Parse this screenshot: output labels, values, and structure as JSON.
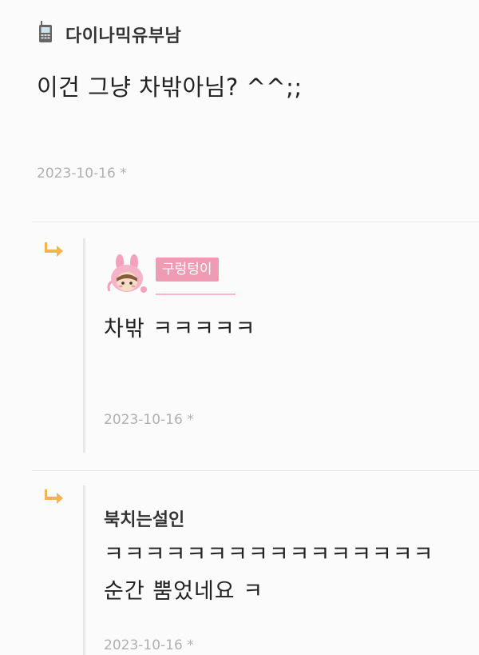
{
  "top_comment": {
    "icon": "mobile-phone-icon",
    "nickname": "다이나믹유부남",
    "text": "이건 그냥 차밖아님? ^^;;",
    "date": "2023-10-16 *"
  },
  "replies": [
    {
      "icon": "reply-arrow-icon",
      "avatar": "pink-bunny-avatar",
      "nickname_badge": "구렁텅이",
      "badge_color": "#f09bb4",
      "text": "차밖 ㅋㅋㅋㅋㅋ",
      "date": "2023-10-16 *"
    },
    {
      "icon": "reply-arrow-icon",
      "nickname": "북치는설인",
      "text_line1": "ㅋㅋㅋㅋㅋㅋㅋㅋㅋㅋㅋㅋㅋㅋㅋㅋ",
      "text_line2": "순간 뿜었네요 ㅋ",
      "date": "2023-10-16 *"
    }
  ],
  "colors": {
    "reply_arrow": "#f3b54a",
    "date_text": "#b0b0b0",
    "divider": "#e6e6e6"
  }
}
